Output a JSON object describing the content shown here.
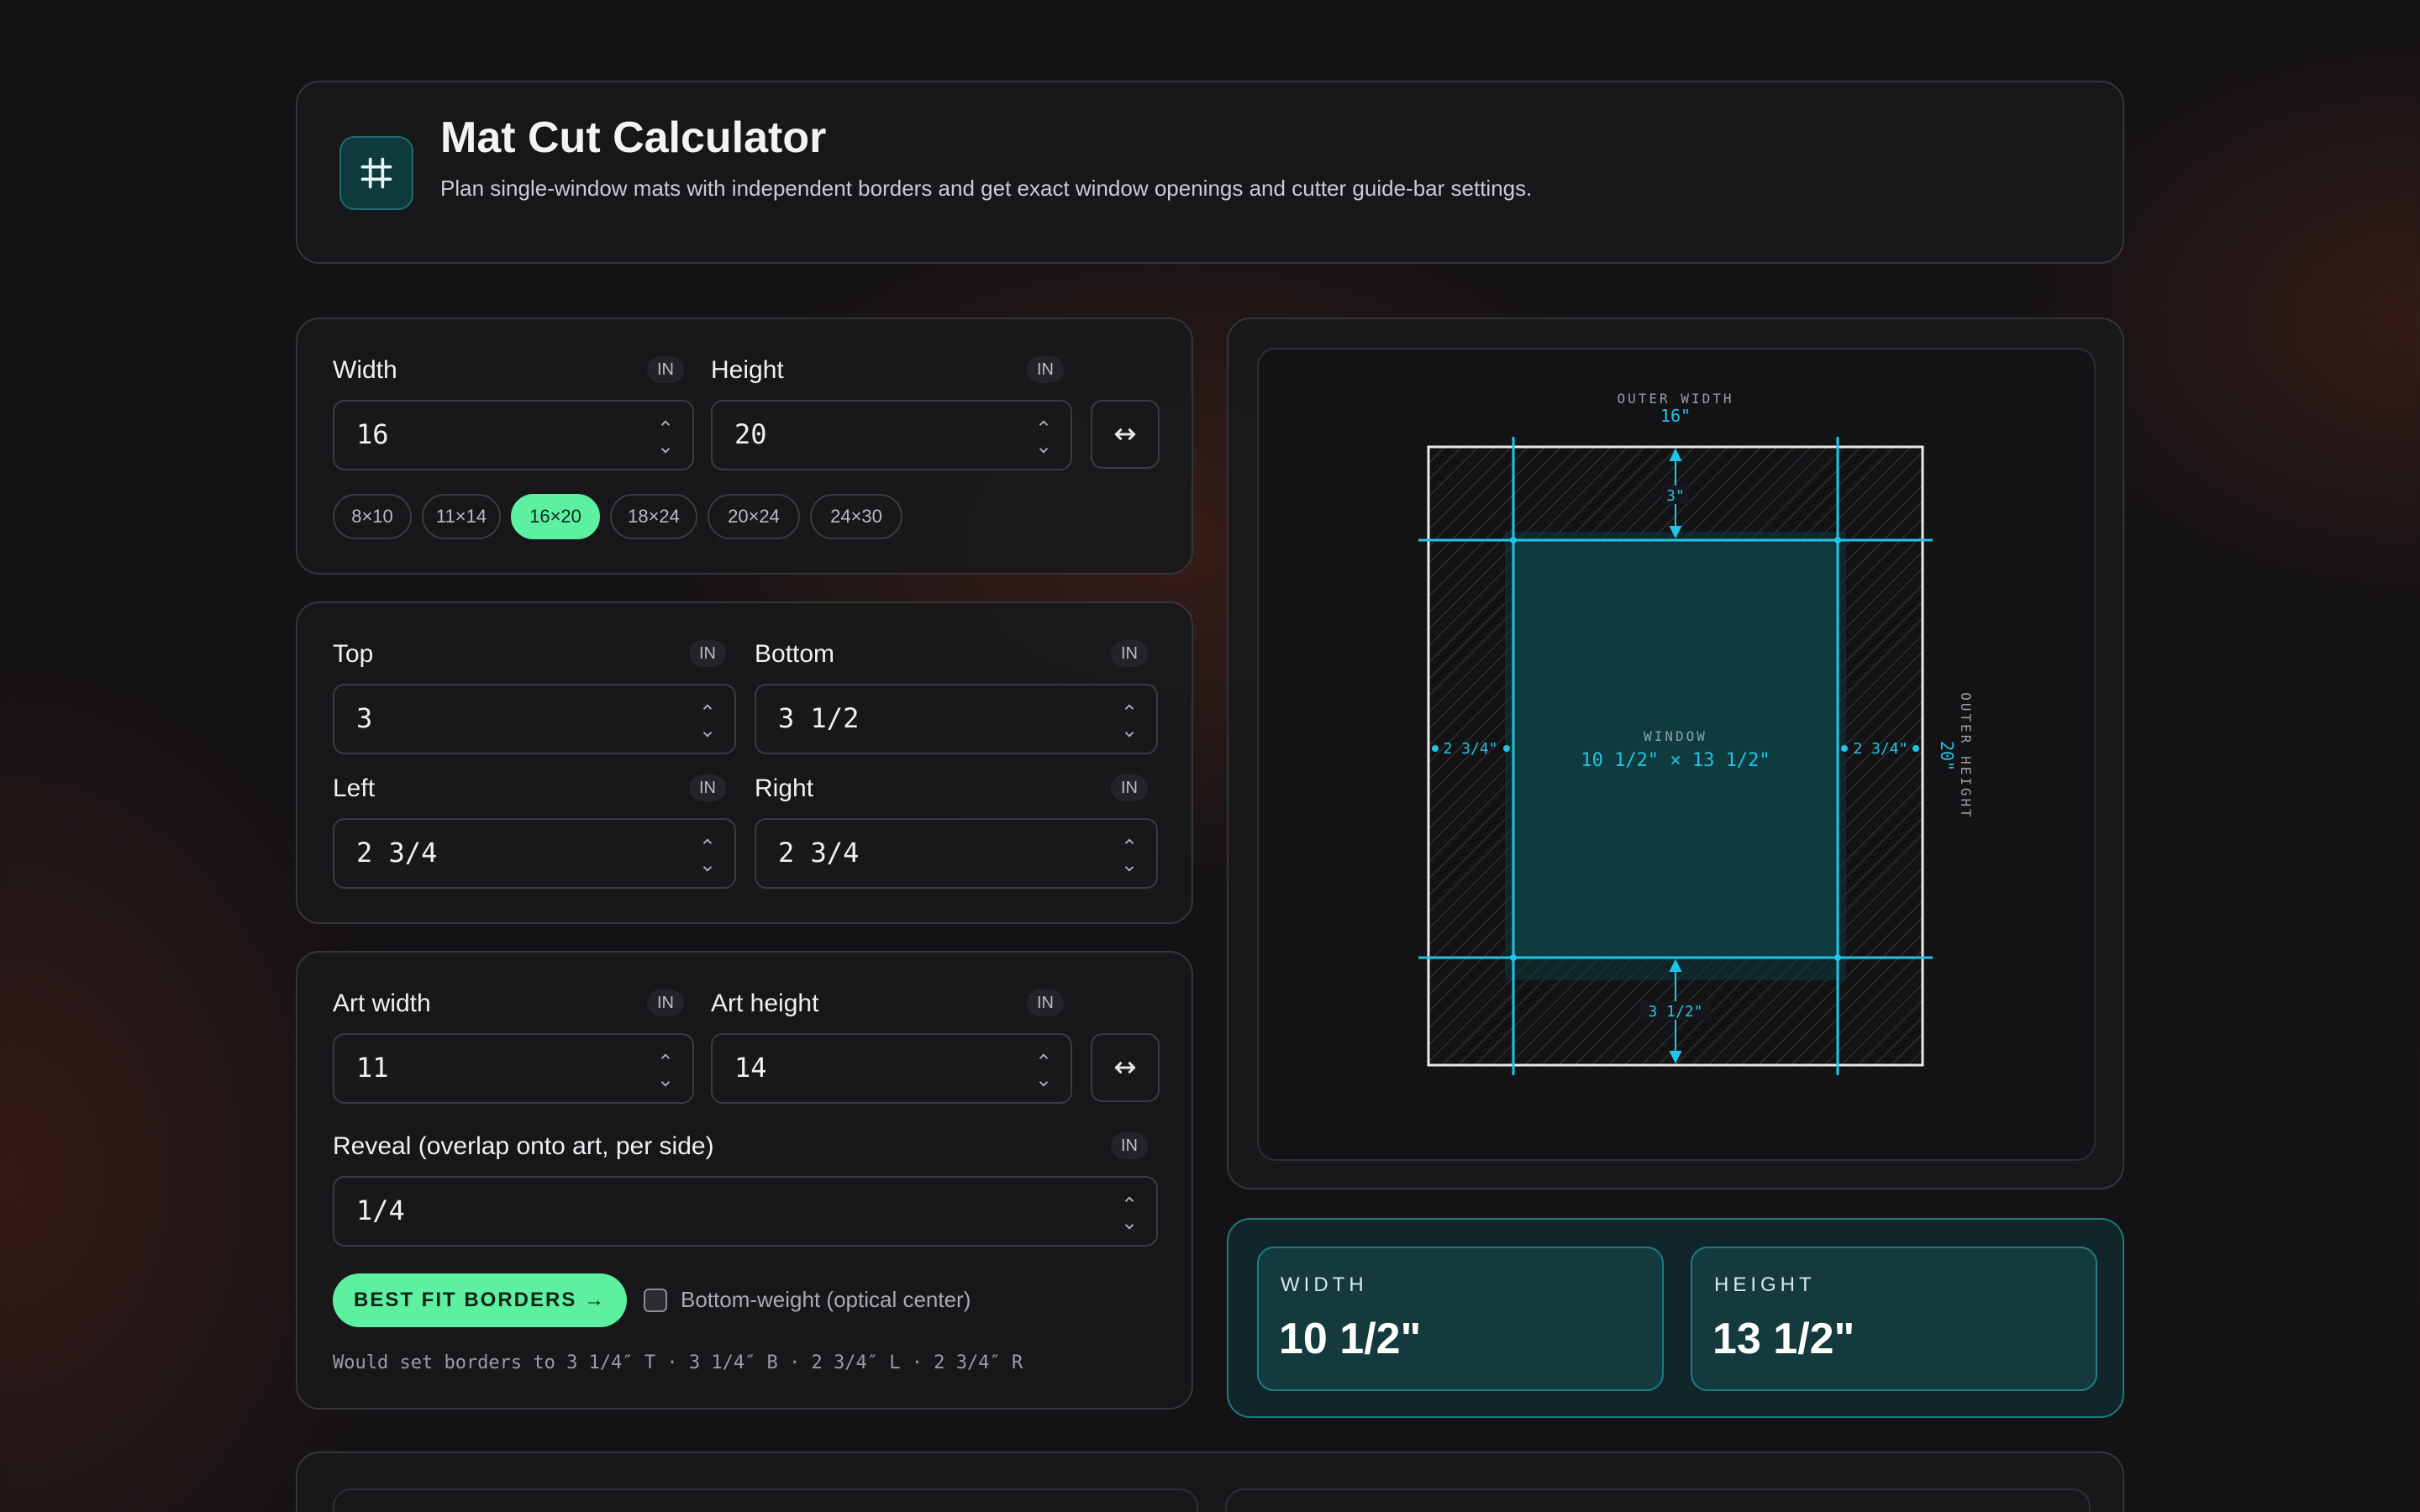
{
  "app": {
    "title": "Mat Cut Calculator",
    "subtitle": "Plan single-window mats with independent borders and get exact window openings and cutter guide-bar settings.",
    "icon": "grid-hash-icon"
  },
  "outer": {
    "width_label": "Width",
    "height_label": "Height",
    "unit": "IN",
    "width_value": "16",
    "height_value": "20",
    "presets": [
      "8×10",
      "11×14",
      "16×20",
      "18×24",
      "20×24",
      "24×30"
    ],
    "active_preset": "16×20"
  },
  "borders": {
    "top_label": "Top",
    "bottom_label": "Bottom",
    "left_label": "Left",
    "right_label": "Right",
    "unit": "IN",
    "top_value": "3",
    "bottom_value": "3 1/2",
    "left_value": "2 3/4",
    "right_value": "2 3/4"
  },
  "art": {
    "width_label": "Art width",
    "height_label": "Art height",
    "unit": "IN",
    "width_value": "11",
    "height_value": "14",
    "reveal_label": "Reveal (overlap onto art, per side)",
    "reveal_value": "1/4",
    "best_fit_label": "BEST FIT BORDERS →",
    "bottom_weight_label": "Bottom-weight (optical center)",
    "bottom_weight_checked": false,
    "hint": "Would set borders to 3 1/4″ T · 3 1/4″ B · 2 3/4″ L · 2 3/4″ R"
  },
  "diagram": {
    "outer_width_label": "OUTER WIDTH",
    "outer_width_value": "16\"",
    "outer_height_label": "OUTER HEIGHT",
    "outer_height_value": "20\"",
    "top_dim": "3\"",
    "bottom_dim": "3 1/2\"",
    "left_dim": "2 3/4\"",
    "right_dim": "2 3/4\"",
    "window_label": "WINDOW",
    "window_dims": "10 1/2\" × 13 1/2\"",
    "accent": "#22c3e6"
  },
  "result": {
    "width_label": "WIDTH",
    "width_value": "10 1/2\"",
    "height_label": "HEIGHT",
    "height_value": "13 1/2\""
  },
  "colors": {
    "accent_green": "#5ef0a1",
    "accent_cyan": "#22c3e6",
    "background": "#141214"
  }
}
